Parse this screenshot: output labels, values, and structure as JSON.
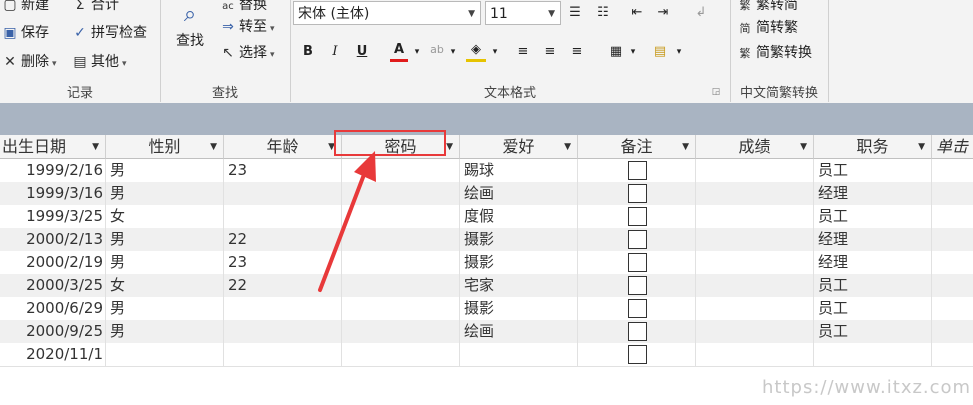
{
  "ribbon": {
    "records_group": {
      "label": "记录",
      "new": "新建",
      "save": "保存",
      "delete": "删除",
      "totals": "合计",
      "spelling": "拼写检查",
      "other": "其他"
    },
    "find_group": {
      "label": "查找",
      "find": "查找",
      "replace": "替换",
      "goto": "转至",
      "select": "选择"
    },
    "text_format_group": {
      "label": "文本格式",
      "font": "宋体 (主体)",
      "size": "11",
      "bold": "B",
      "italic": "I",
      "underline": "U",
      "font_color": "A",
      "highlight": "ab"
    },
    "chinese_group": {
      "label": "中文简繁转换",
      "to_simplified": "繁转简",
      "to_traditional": "简转繁",
      "convert": "简繁转换"
    }
  },
  "table": {
    "columns": [
      "出生日期",
      "性别",
      "年龄",
      "密码",
      "爱好",
      "备注",
      "成绩",
      "职务",
      "单击"
    ],
    "rows": [
      {
        "date": "1999/2/16",
        "gender": "男",
        "age": "23",
        "password": "",
        "hobby": "踢球",
        "score": "",
        "role": "员工"
      },
      {
        "date": "1999/3/16",
        "gender": "男",
        "age": "",
        "password": "",
        "hobby": "绘画",
        "score": "",
        "role": "经理"
      },
      {
        "date": "1999/3/25",
        "gender": "女",
        "age": "",
        "password": "",
        "hobby": "度假",
        "score": "",
        "role": "员工"
      },
      {
        "date": "2000/2/13",
        "gender": "男",
        "age": "22",
        "password": "",
        "hobby": "摄影",
        "score": "",
        "role": "经理"
      },
      {
        "date": "2000/2/19",
        "gender": "男",
        "age": "23",
        "password": "",
        "hobby": "摄影",
        "score": "",
        "role": "经理"
      },
      {
        "date": "2000/3/25",
        "gender": "女",
        "age": "22",
        "password": "",
        "hobby": "宅家",
        "score": "",
        "role": "员工"
      },
      {
        "date": "2000/6/29",
        "gender": "男",
        "age": "",
        "password": "",
        "hobby": "摄影",
        "score": "",
        "role": "员工"
      },
      {
        "date": "2000/9/25",
        "gender": "男",
        "age": "",
        "password": "",
        "hobby": "绘画",
        "score": "",
        "role": "员工"
      },
      {
        "date": "2020/11/1",
        "gender": "",
        "age": "",
        "password": "",
        "hobby": "",
        "score": "",
        "role": ""
      }
    ]
  },
  "annotation": {
    "color": "#e8393a"
  },
  "watermark": "https://www.itxz.com",
  "colors": {
    "header_band": "#a9b4c2",
    "alt_row": "#f0f0f0"
  }
}
